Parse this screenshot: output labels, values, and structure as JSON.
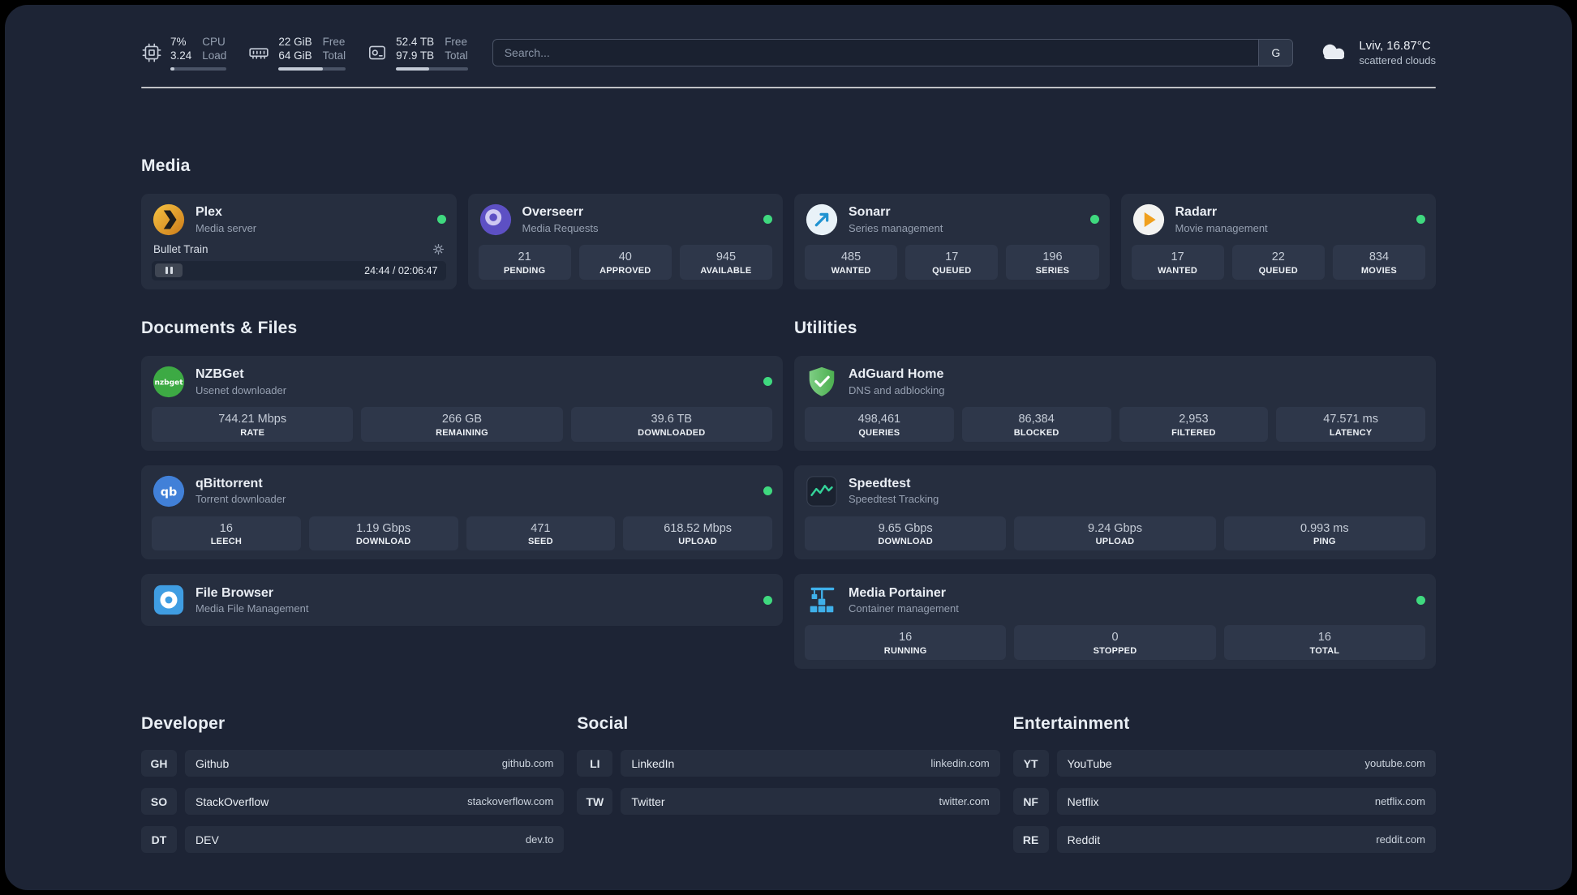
{
  "topbar": {
    "cpu": {
      "icon": "cpu-chip-icon",
      "percent": "7%",
      "load": "3.24",
      "label_top": "CPU",
      "label_bottom": "Load",
      "bar_pct": 7
    },
    "ram": {
      "icon": "memory-icon",
      "free": "22 GiB",
      "free_label": "Free",
      "total": "64 GiB",
      "total_label": "Total",
      "bar_pct": 66
    },
    "disk": {
      "icon": "hard-disk-icon",
      "free": "52.4 TB",
      "free_label": "Free",
      "total": "97.9 TB",
      "total_label": "Total",
      "bar_pct": 46
    },
    "search": {
      "placeholder": "Search...",
      "provider_button": "G"
    },
    "weather": {
      "icon": "cloud-icon",
      "location": "Lviv, 16.87°C",
      "condition": "scattered clouds"
    }
  },
  "sections": {
    "media": {
      "title": "Media",
      "cards": [
        {
          "name": "Plex",
          "desc": "Media server",
          "icon": "plex-icon",
          "online": true,
          "player": {
            "track": "Bullet Train",
            "time": "24:44 / 02:06:47"
          }
        },
        {
          "name": "Overseerr",
          "desc": "Media Requests",
          "icon": "overseerr-icon",
          "online": true,
          "stats": [
            {
              "value": "21",
              "label": "PENDING"
            },
            {
              "value": "40",
              "label": "APPROVED"
            },
            {
              "value": "945",
              "label": "AVAILABLE"
            }
          ]
        },
        {
          "name": "Sonarr",
          "desc": "Series management",
          "icon": "sonarr-icon",
          "online": true,
          "stats": [
            {
              "value": "485",
              "label": "WANTED"
            },
            {
              "value": "17",
              "label": "QUEUED"
            },
            {
              "value": "196",
              "label": "SERIES"
            }
          ]
        },
        {
          "name": "Radarr",
          "desc": "Movie management",
          "icon": "radarr-icon",
          "online": true,
          "stats": [
            {
              "value": "17",
              "label": "WANTED"
            },
            {
              "value": "22",
              "label": "QUEUED"
            },
            {
              "value": "834",
              "label": "MOVIES"
            }
          ]
        }
      ]
    },
    "documents": {
      "title": "Documents & Files",
      "cards": [
        {
          "name": "NZBGet",
          "desc": "Usenet downloader",
          "icon": "nzbget-icon",
          "icon_text": "nzbget",
          "online": true,
          "stats": [
            {
              "value": "744.21 Mbps",
              "label": "RATE"
            },
            {
              "value": "266 GB",
              "label": "REMAINING"
            },
            {
              "value": "39.6 TB",
              "label": "DOWNLOADED"
            }
          ]
        },
        {
          "name": "qBittorrent",
          "desc": "Torrent downloader",
          "icon": "qbittorrent-icon",
          "icon_text": "qb",
          "online": true,
          "stats": [
            {
              "value": "16",
              "label": "LEECH"
            },
            {
              "value": "1.19 Gbps",
              "label": "DOWNLOAD"
            },
            {
              "value": "471",
              "label": "SEED"
            },
            {
              "value": "618.52 Mbps",
              "label": "UPLOAD"
            }
          ]
        },
        {
          "name": "File Browser",
          "desc": "Media File Management",
          "icon": "filebrowser-icon",
          "online": true,
          "stats": []
        }
      ]
    },
    "utilities": {
      "title": "Utilities",
      "cards": [
        {
          "name": "AdGuard Home",
          "desc": "DNS and adblocking",
          "icon": "adguard-shield-icon",
          "stats": [
            {
              "value": "498,461",
              "label": "QUERIES"
            },
            {
              "value": "86,384",
              "label": "BLOCKED"
            },
            {
              "value": "2,953",
              "label": "FILTERED"
            },
            {
              "value": "47.571 ms",
              "label": "LATENCY"
            }
          ]
        },
        {
          "name": "Speedtest",
          "desc": "Speedtest Tracking",
          "icon": "speedtest-graph-icon",
          "stats": [
            {
              "value": "9.65 Gbps",
              "label": "DOWNLOAD"
            },
            {
              "value": "9.24 Gbps",
              "label": "UPLOAD"
            },
            {
              "value": "0.993 ms",
              "label": "PING"
            }
          ]
        },
        {
          "name": "Media Portainer",
          "desc": "Container management",
          "icon": "portainer-crane-icon",
          "online": true,
          "stats": [
            {
              "value": "16",
              "label": "RUNNING"
            },
            {
              "value": "0",
              "label": "STOPPED"
            },
            {
              "value": "16",
              "label": "TOTAL"
            }
          ]
        }
      ]
    }
  },
  "bookmarks": [
    {
      "title": "Developer",
      "links": [
        {
          "abbr": "GH",
          "name": "Github",
          "url": "github.com"
        },
        {
          "abbr": "SO",
          "name": "StackOverflow",
          "url": "stackoverflow.com"
        },
        {
          "abbr": "DT",
          "name": "DEV",
          "url": "dev.to"
        }
      ]
    },
    {
      "title": "Social",
      "links": [
        {
          "abbr": "LI",
          "name": "LinkedIn",
          "url": "linkedin.com"
        },
        {
          "abbr": "TW",
          "name": "Twitter",
          "url": "twitter.com"
        }
      ]
    },
    {
      "title": "Entertainment",
      "links": [
        {
          "abbr": "YT",
          "name": "YouTube",
          "url": "youtube.com"
        },
        {
          "abbr": "NF",
          "name": "Netflix",
          "url": "netflix.com"
        },
        {
          "abbr": "RE",
          "name": "Reddit",
          "url": "reddit.com"
        }
      ]
    }
  ],
  "colors": {
    "page_bg": "#1d2435",
    "card_bg": "#262e3f",
    "stat_bg": "#2e374a",
    "status_online": "#3fd97f",
    "plex_gold": "#e5a00d",
    "overseerr_purple": "#5d50c4",
    "sonarr_blue": "#2193d1",
    "radarr_orange": "#f0a01e",
    "nzbget_green": "#3daa44",
    "qbittorrent_blue": "#4180d8",
    "filebrowser_blue": "#3f9de2",
    "adguard_green": "#4caf50",
    "speedtest_green": "#34d399",
    "portainer_blue": "#3fb0ea"
  }
}
